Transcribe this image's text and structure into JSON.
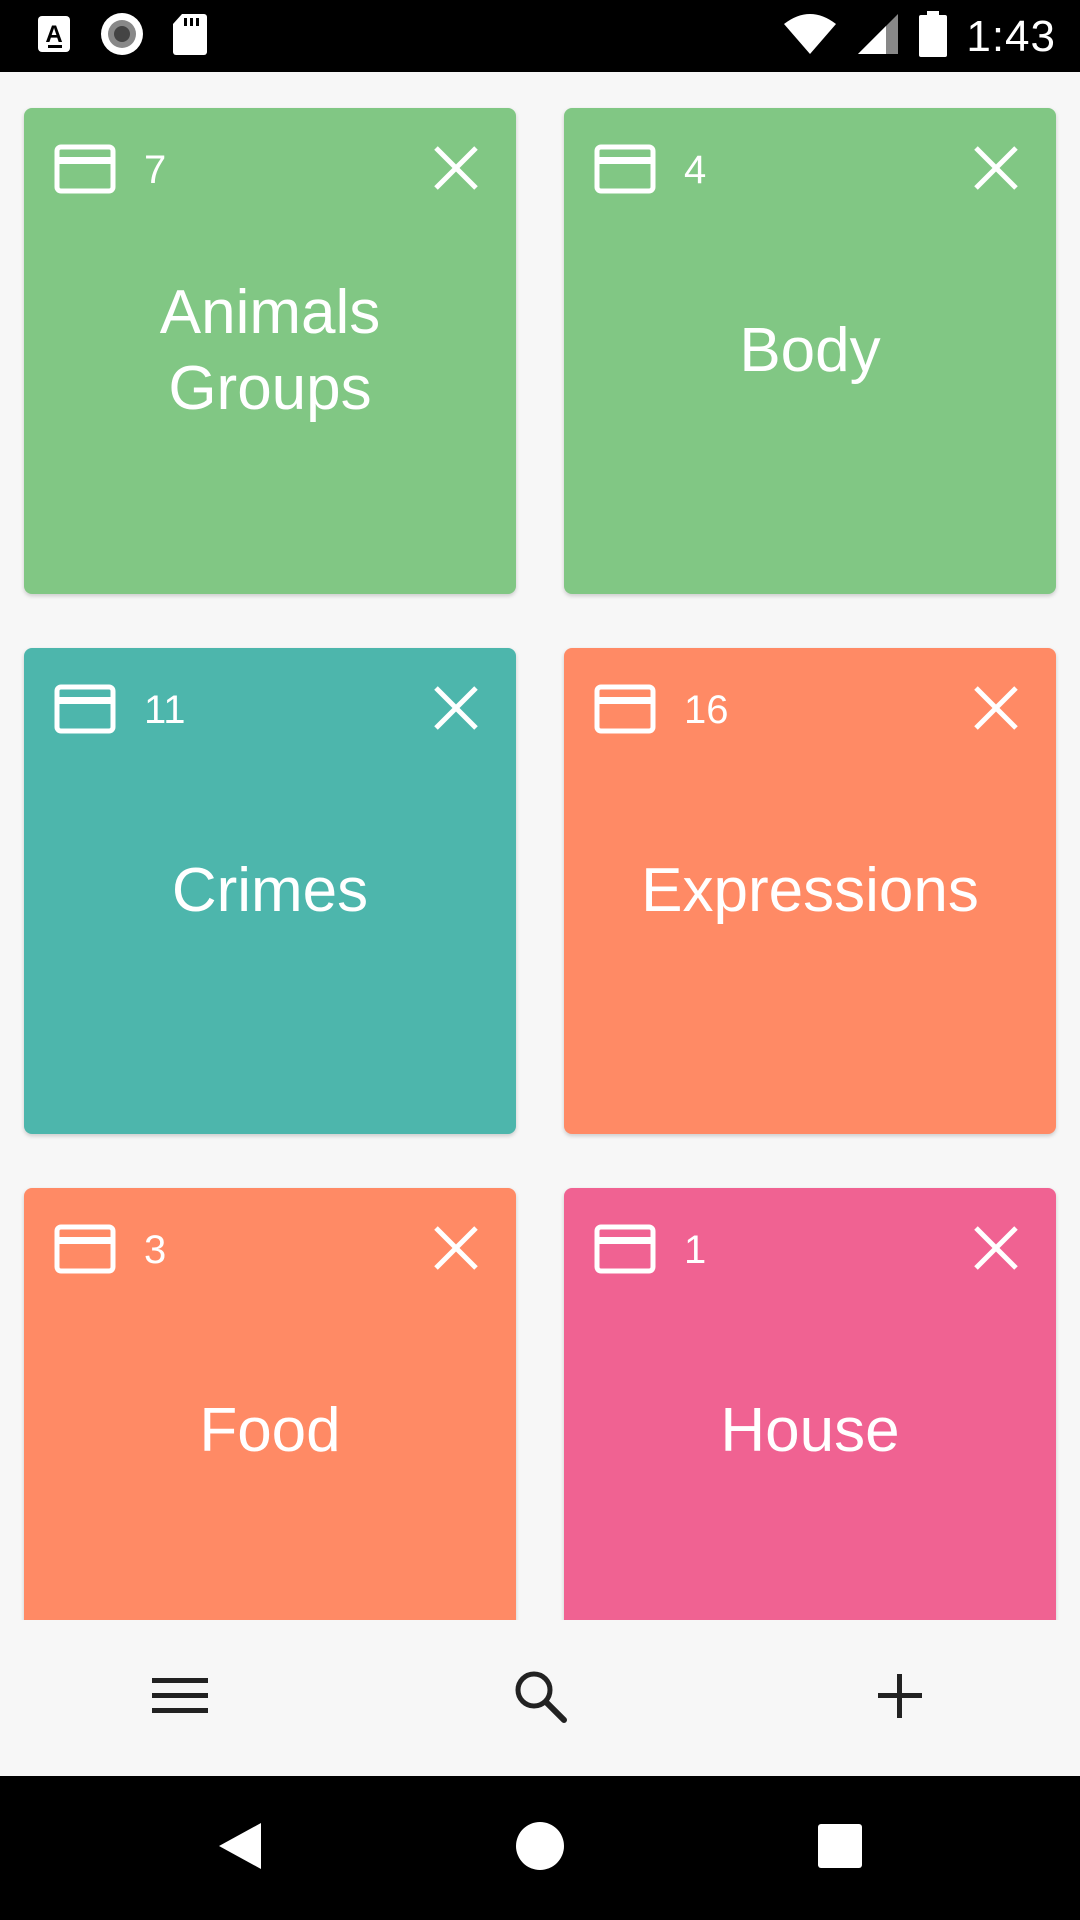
{
  "status_bar": {
    "time": "1:43",
    "left_icons": [
      "a-notification-icon",
      "record-icon",
      "sd-card-icon"
    ],
    "right_icons": [
      "wifi-icon",
      "cellular-signal-icon",
      "battery-icon"
    ]
  },
  "cards": [
    {
      "count": "7",
      "title_lines": [
        "Animals",
        "Groups"
      ],
      "color": "#81c784"
    },
    {
      "count": "4",
      "title_lines": [
        "Body"
      ],
      "color": "#81c784"
    },
    {
      "count": "11",
      "title_lines": [
        "Crimes"
      ],
      "color": "#4db6ac"
    },
    {
      "count": "16",
      "title_lines": [
        "Expressions"
      ],
      "color": "#ff8a65"
    },
    {
      "count": "3",
      "title_lines": [
        "Food"
      ],
      "color": "#ff8a65"
    },
    {
      "count": "1",
      "title_lines": [
        "House"
      ],
      "color": "#f06292"
    }
  ],
  "bottom_bar": {
    "icons": [
      "menu-icon",
      "search-icon",
      "add-icon"
    ]
  },
  "nav_bar": {
    "icons": [
      "back-icon",
      "home-icon",
      "recents-icon"
    ]
  }
}
